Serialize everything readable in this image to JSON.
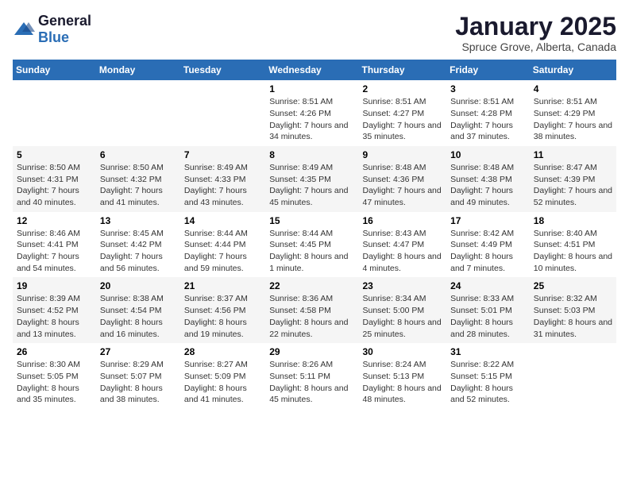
{
  "logo": {
    "general": "General",
    "blue": "Blue"
  },
  "title": "January 2025",
  "subtitle": "Spruce Grove, Alberta, Canada",
  "days_of_week": [
    "Sunday",
    "Monday",
    "Tuesday",
    "Wednesday",
    "Thursday",
    "Friday",
    "Saturday"
  ],
  "weeks": [
    [
      {
        "day": "",
        "info": ""
      },
      {
        "day": "",
        "info": ""
      },
      {
        "day": "",
        "info": ""
      },
      {
        "day": "1",
        "info": "Sunrise: 8:51 AM\nSunset: 4:26 PM\nDaylight: 7 hours and 34 minutes."
      },
      {
        "day": "2",
        "info": "Sunrise: 8:51 AM\nSunset: 4:27 PM\nDaylight: 7 hours and 35 minutes."
      },
      {
        "day": "3",
        "info": "Sunrise: 8:51 AM\nSunset: 4:28 PM\nDaylight: 7 hours and 37 minutes."
      },
      {
        "day": "4",
        "info": "Sunrise: 8:51 AM\nSunset: 4:29 PM\nDaylight: 7 hours and 38 minutes."
      }
    ],
    [
      {
        "day": "5",
        "info": "Sunrise: 8:50 AM\nSunset: 4:31 PM\nDaylight: 7 hours and 40 minutes."
      },
      {
        "day": "6",
        "info": "Sunrise: 8:50 AM\nSunset: 4:32 PM\nDaylight: 7 hours and 41 minutes."
      },
      {
        "day": "7",
        "info": "Sunrise: 8:49 AM\nSunset: 4:33 PM\nDaylight: 7 hours and 43 minutes."
      },
      {
        "day": "8",
        "info": "Sunrise: 8:49 AM\nSunset: 4:35 PM\nDaylight: 7 hours and 45 minutes."
      },
      {
        "day": "9",
        "info": "Sunrise: 8:48 AM\nSunset: 4:36 PM\nDaylight: 7 hours and 47 minutes."
      },
      {
        "day": "10",
        "info": "Sunrise: 8:48 AM\nSunset: 4:38 PM\nDaylight: 7 hours and 49 minutes."
      },
      {
        "day": "11",
        "info": "Sunrise: 8:47 AM\nSunset: 4:39 PM\nDaylight: 7 hours and 52 minutes."
      }
    ],
    [
      {
        "day": "12",
        "info": "Sunrise: 8:46 AM\nSunset: 4:41 PM\nDaylight: 7 hours and 54 minutes."
      },
      {
        "day": "13",
        "info": "Sunrise: 8:45 AM\nSunset: 4:42 PM\nDaylight: 7 hours and 56 minutes."
      },
      {
        "day": "14",
        "info": "Sunrise: 8:44 AM\nSunset: 4:44 PM\nDaylight: 7 hours and 59 minutes."
      },
      {
        "day": "15",
        "info": "Sunrise: 8:44 AM\nSunset: 4:45 PM\nDaylight: 8 hours and 1 minute."
      },
      {
        "day": "16",
        "info": "Sunrise: 8:43 AM\nSunset: 4:47 PM\nDaylight: 8 hours and 4 minutes."
      },
      {
        "day": "17",
        "info": "Sunrise: 8:42 AM\nSunset: 4:49 PM\nDaylight: 8 hours and 7 minutes."
      },
      {
        "day": "18",
        "info": "Sunrise: 8:40 AM\nSunset: 4:51 PM\nDaylight: 8 hours and 10 minutes."
      }
    ],
    [
      {
        "day": "19",
        "info": "Sunrise: 8:39 AM\nSunset: 4:52 PM\nDaylight: 8 hours and 13 minutes."
      },
      {
        "day": "20",
        "info": "Sunrise: 8:38 AM\nSunset: 4:54 PM\nDaylight: 8 hours and 16 minutes."
      },
      {
        "day": "21",
        "info": "Sunrise: 8:37 AM\nSunset: 4:56 PM\nDaylight: 8 hours and 19 minutes."
      },
      {
        "day": "22",
        "info": "Sunrise: 8:36 AM\nSunset: 4:58 PM\nDaylight: 8 hours and 22 minutes."
      },
      {
        "day": "23",
        "info": "Sunrise: 8:34 AM\nSunset: 5:00 PM\nDaylight: 8 hours and 25 minutes."
      },
      {
        "day": "24",
        "info": "Sunrise: 8:33 AM\nSunset: 5:01 PM\nDaylight: 8 hours and 28 minutes."
      },
      {
        "day": "25",
        "info": "Sunrise: 8:32 AM\nSunset: 5:03 PM\nDaylight: 8 hours and 31 minutes."
      }
    ],
    [
      {
        "day": "26",
        "info": "Sunrise: 8:30 AM\nSunset: 5:05 PM\nDaylight: 8 hours and 35 minutes."
      },
      {
        "day": "27",
        "info": "Sunrise: 8:29 AM\nSunset: 5:07 PM\nDaylight: 8 hours and 38 minutes."
      },
      {
        "day": "28",
        "info": "Sunrise: 8:27 AM\nSunset: 5:09 PM\nDaylight: 8 hours and 41 minutes."
      },
      {
        "day": "29",
        "info": "Sunrise: 8:26 AM\nSunset: 5:11 PM\nDaylight: 8 hours and 45 minutes."
      },
      {
        "day": "30",
        "info": "Sunrise: 8:24 AM\nSunset: 5:13 PM\nDaylight: 8 hours and 48 minutes."
      },
      {
        "day": "31",
        "info": "Sunrise: 8:22 AM\nSunset: 5:15 PM\nDaylight: 8 hours and 52 minutes."
      },
      {
        "day": "",
        "info": ""
      }
    ]
  ]
}
